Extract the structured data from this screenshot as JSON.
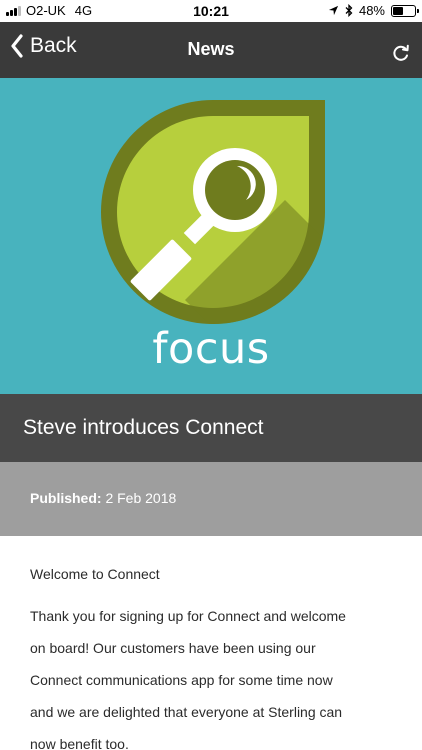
{
  "status_bar": {
    "carrier": "O2-UK",
    "network": "4G",
    "time": "10:21",
    "battery": "48%",
    "battery_level": 0.48
  },
  "nav": {
    "back_label": "Back",
    "title": "News"
  },
  "hero": {
    "logo_word": "focus",
    "background_color": "#48b3be",
    "leaf_dark_color": "#6f7c1e",
    "leaf_light_color": "#b7cf3d"
  },
  "article": {
    "title": "Steve introduces Connect",
    "published_label": "Published:",
    "published_date": "2 Feb 2018",
    "greeting": "Welcome to Connect",
    "lines": [
      "Thank you for signing up for Connect and welcome",
      "on board! Our customers have been using our",
      "Connect communications app for some time now",
      "and we are delighted that everyone at Sterling can",
      "now benefit too."
    ]
  }
}
